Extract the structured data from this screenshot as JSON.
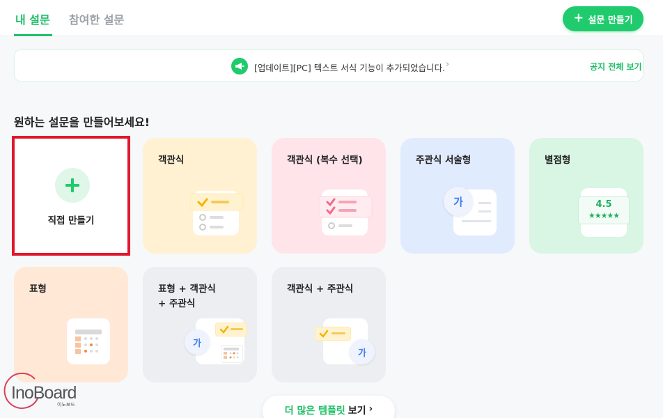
{
  "tabs": {
    "active": "내 설문",
    "inactive": "참여한 설문"
  },
  "create_button": {
    "label": "설문 만들기"
  },
  "notice": {
    "text": "[업데이트][PC] 텍스트 서식 기능이 추가되었습니다.",
    "link": "공지 전체 보기"
  },
  "section_title": "원하는 설문을 만들어보세요!",
  "direct_card": {
    "label": "직접 만들기"
  },
  "cards": {
    "objective": "객관식",
    "multiple": "객관식 (복수 선택)",
    "subjective": "주관식 서술형",
    "rating": "별점형",
    "table": "표형",
    "table_mixed": "표형 + 객관식\n+ 주관식",
    "obj_subj": "객관식 + 주관식"
  },
  "art": {
    "rating_value": "4.5",
    "ga_glyph": "가",
    "ga_glyph_2": "가",
    "ga_glyph_3": "가"
  },
  "more_button": {
    "green": "더 많은 템플릿",
    "dark": "보기"
  },
  "watermark": {
    "text": "InoBoard",
    "sub": "이노보드"
  },
  "colors": {
    "brand_green": "#1fcb6c",
    "highlight_red": "#e0182d"
  }
}
